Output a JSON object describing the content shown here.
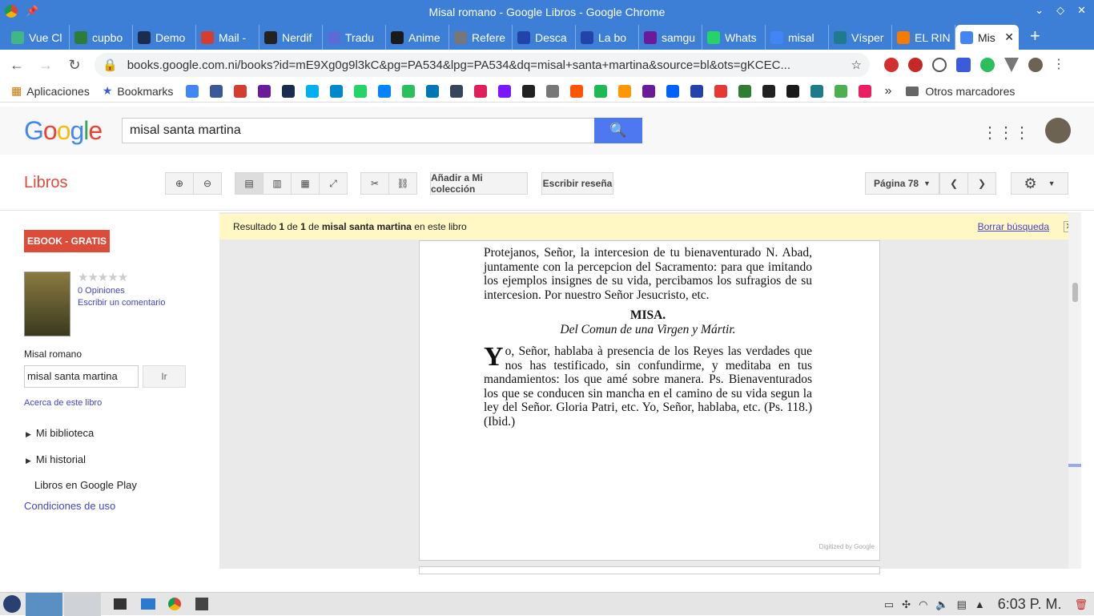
{
  "window": {
    "title": "Misal romano - Google Libros - Google Chrome"
  },
  "tabs": [
    {
      "label": "Vue Cl",
      "color": "#41b883"
    },
    {
      "label": "cupbo",
      "color": "#2d7d3a"
    },
    {
      "label": "Demo",
      "color": "#1b2d4f"
    },
    {
      "label": "Mail -",
      "color": "#d23f31"
    },
    {
      "label": "Nerdif",
      "color": "#222222"
    },
    {
      "label": "Tradu",
      "color": "#5b6bd8"
    },
    {
      "label": "Anime",
      "color": "#1a1a1a"
    },
    {
      "label": "Refere",
      "color": "#777777"
    },
    {
      "label": "Desca",
      "color": "#2244aa"
    },
    {
      "label": "La bo",
      "color": "#2244aa"
    },
    {
      "label": "samgu",
      "color": "#6a1b9a"
    },
    {
      "label": "Whats",
      "color": "#25d366"
    },
    {
      "label": "misal",
      "color": "#4285f4"
    },
    {
      "label": "Vísper",
      "color": "#1f7a8c"
    },
    {
      "label": "EL RIN",
      "color": "#f57c00"
    },
    {
      "label": "Mis",
      "color": "#4285f4",
      "active": true
    }
  ],
  "toolbar": {
    "url": "books.google.com.ni/books?id=mE9Xg0g9l3kC&pg=PA534&lpg=PA534&dq=misal+santa+martina&source=bl&ots=gKCEC..."
  },
  "bookmarks": {
    "apps_label": "Aplicaciones",
    "bookmarks_label": "Bookmarks",
    "other_label": "Otros marcadores",
    "icons": [
      "#4285f4",
      "#3b5998",
      "#d23f31",
      "#6a1b9a",
      "#1b2d4f",
      "#00aff0",
      "#0088cc",
      "#25d366",
      "#0084ff",
      "#2dbe60",
      "#0077b5",
      "#35465c",
      "#e01e5a",
      "#7b16ff",
      "#222222",
      "#777777",
      "#ff5500",
      "#1db954",
      "#ff9800",
      "#6a1b9a",
      "#0061ff",
      "#2244aa",
      "#e53935",
      "#2e7d32",
      "#222222",
      "#1a1a1a",
      "#1f7a8c",
      "#4caf50",
      "#e91e63"
    ]
  },
  "google": {
    "search_value": "misal santa martina"
  },
  "bookbar": {
    "section": "Libros",
    "add_collection": "Añadir a Mi colección",
    "write_review": "Escribir reseña",
    "page_label": "Página 78"
  },
  "sidebar": {
    "ebook_label": "EBOOK - GRATIS",
    "stars": "★★★★★",
    "opinions": "0 Opiniones",
    "write_comment": "Escribir un comentario",
    "book_title": "Misal romano",
    "search_value": "misal santa martina",
    "go_label": "Ir",
    "about": "Acerca de este libro",
    "my_library": "Mi biblioteca",
    "my_history": "Mi historial",
    "play": "Libros en Google Play",
    "terms": "Condiciones de uso"
  },
  "result": {
    "prefix": "Resultado",
    "n": "1",
    "de": "de",
    "total": "1",
    "de2": "de",
    "query": "misal santa martina",
    "suffix": "en este libro",
    "clear": "Borrar búsqueda"
  },
  "page_text": {
    "p1": "Protejanos, Señor, la intercesion de tu bienaventurado N. Abad, juntamente con la percepcion del Sacramento: para que imitando los ejemplos insignes de su vida, percibamos los sufragios de su intercesion. Por nuestro Señor Jesucristo, etc.",
    "heading": "MISA.",
    "subheading": "Del Comun de una Virgen y Mártir.",
    "initial": "Y",
    "p2": "o, Señor, hablaba à presencia de los Reyes las verdades que nos has testificado, sin confundirme, y meditaba en tus mandamientos: los que amé sobre manera. Ps. Bienaventurados los que se conducen sin mancha en el camino de su vida segun la ley del Señor. Gloria Patri, etc. Yo, Señor, hablaba, etc.    (Ps. 118.)    (Ibid.)",
    "digitized": "Digitized by Google"
  },
  "taskbar": {
    "clock": "6:03 P. M."
  }
}
